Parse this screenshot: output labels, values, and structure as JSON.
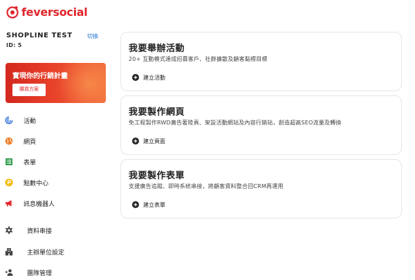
{
  "brand": {
    "logo_text": "feversocial",
    "accent": "#e0262c"
  },
  "account": {
    "name": "SHOPLINE TEST",
    "id_label": "ID: 5",
    "switch_label": "切換"
  },
  "promo": {
    "title": "實現你的行銷計畫",
    "button_label": "購買方案"
  },
  "nav": {
    "items": [
      {
        "label": "活動",
        "icon": "campaign-icon"
      },
      {
        "label": "網頁",
        "icon": "globe-icon"
      },
      {
        "label": "表單",
        "icon": "form-icon"
      },
      {
        "label": "點數中心",
        "icon": "points-icon"
      },
      {
        "label": "訊息機器人",
        "icon": "megaphone-icon"
      }
    ],
    "settings": [
      {
        "label": "資料串接",
        "icon": "gear-icon"
      },
      {
        "label": "主辦單位設定",
        "icon": "building-icon"
      },
      {
        "label": "團隊管理",
        "icon": "add-person-icon"
      }
    ]
  },
  "cards": [
    {
      "title": "我要舉辦活動",
      "description": "20+ 互動模式達成招募客戶、社群擴散及顧客黏標目標",
      "action_label": "建立活動"
    },
    {
      "title": "我要製作網頁",
      "description": "免工程製作RWD廣告著陸頁、架設活動網站及內容行銷站，創造超高SEO流量及轉換",
      "action_label": "建立頁面"
    },
    {
      "title": "我要製作表單",
      "description": "支援廣告追蹤、即時系統串接，將顧客資料整合回CRM再運用",
      "action_label": "建立表單"
    }
  ]
}
